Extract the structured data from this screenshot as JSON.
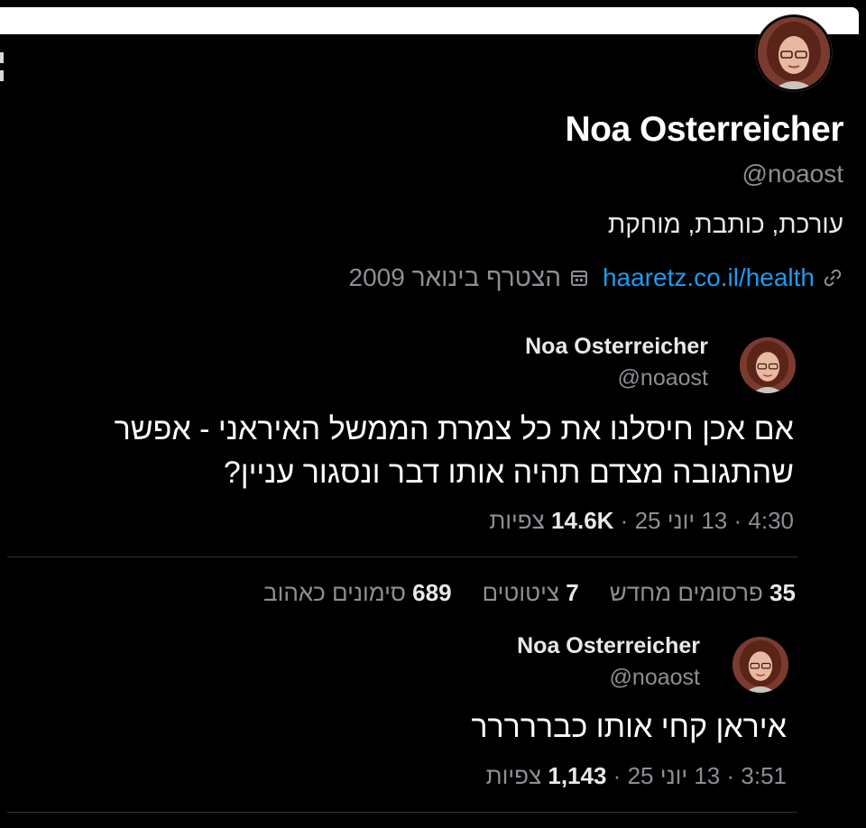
{
  "profile": {
    "name": "Noa Osterreicher",
    "handle": "@noaost",
    "bio": "עורכת, כותבת, מוחקת",
    "link": "haaretz.co.il/health",
    "joined": "הצטרף בינואר 2009",
    "link_icon": "link-icon",
    "joined_icon": "calendar-icon"
  },
  "tweets": [
    {
      "name": "Noa Osterreicher",
      "handle": "@noaost",
      "text_line1": "אם אכן חיסלנו את כל צמרת הממשל האיראני - אפשר",
      "text_line2": "שהתגובה מצדם תהיה אותו דבר ונסגור עניין?",
      "time": "4:30",
      "date": "13 יוני 25",
      "views_count": "14.6K",
      "views_label": "צפיות",
      "separator": "·"
    },
    {
      "name": "Noa Osterreicher",
      "handle": "@noaost",
      "text_line1": "איראן קחי אותו כבררררר",
      "time": "3:51",
      "date": "13 יוני 25",
      "views_count": "1,143",
      "views_label": "צפיות",
      "separator": "·"
    }
  ],
  "stats": {
    "reposts_count": "35",
    "reposts_label": "פרסומים מחדש",
    "quotes_count": "7",
    "quotes_label": "ציטוטים",
    "likes_count": "689",
    "likes_label": "סימונים כאהוב"
  },
  "colors": {
    "background": "#000000",
    "link": "#1d9bf0",
    "secondary_text": "#8b8f94",
    "divider": "#2f3336"
  }
}
